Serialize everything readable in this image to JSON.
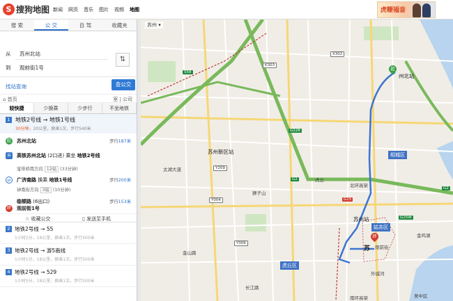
{
  "topbar": {
    "logo_mark": "S",
    "logo_text": "搜狗地图",
    "nav": [
      "新闻",
      "网页",
      "音乐",
      "图片",
      "视频",
      "地图"
    ],
    "active_nav": "地图",
    "ad_text": "虎鞭福音"
  },
  "panel": {
    "mode_tabs": [
      "搜 索",
      "公 交",
      "自 驾",
      "收藏夹"
    ],
    "active_mode": "公 交",
    "from_label": "从",
    "from_value": "苏州北站",
    "to_label": "到",
    "to_value": "观前街1号",
    "swap_icon": "⇅",
    "station_search_link": "找站查询",
    "search_button": "查公交",
    "crumb_home": "首页",
    "crumb_right": "室 | 公司",
    "pref_tabs": [
      "较快捷",
      "少换乘",
      "少步行",
      "不坐地铁"
    ],
    "active_pref": "较快捷"
  },
  "plan1": {
    "num": "1",
    "title": "地铁2号线 → 地铁1号线",
    "summary_time": "30分钟",
    "summary_rest": "，20公里，换乘1次，步行540米",
    "steps": {
      "start": {
        "name": "苏州北站",
        "walk_prefix": "步行",
        "walk": "187米"
      },
      "board1": {
        "station": "高铁苏州北站",
        "gate": "2口进",
        "ride": "乘坐",
        "line": "地铁2号线",
        "direction": "宝带桥南方向",
        "stops": "12站",
        "mins": "33分钟"
      },
      "transfer": {
        "station": "广济南路",
        "change": "换乘",
        "line": "地铁1号线",
        "walk_prefix": "步行",
        "walk": "200米",
        "direction": "钟南街方向",
        "stops": "3站",
        "mins": "10分钟"
      },
      "alight": {
        "station": "临顿路",
        "exit": "6出口",
        "walk_prefix": "步行",
        "walk": "153米"
      },
      "end": {
        "name": "观前街1号"
      }
    },
    "fav_label": "收藏公交",
    "send_label": "发送至手机"
  },
  "plans": [
    {
      "num": "2",
      "title": "地铁2号线 → 55",
      "summary": "1小时2分，18公里，换乘1次，步行400米"
    },
    {
      "num": "3",
      "title": "地铁2号线 → 游5南线",
      "summary": "1小时1分，18公里，换乘1次，步行500米"
    },
    {
      "num": "4",
      "title": "地铁2号线 → 529",
      "summary": "1小时5分，18公里，换乘1次，步行500米"
    }
  ],
  "map": {
    "city": "苏州 ▾",
    "labels": {
      "suzhou_north": "州北站",
      "suzhou_xinqu": "苏州新区站",
      "suzhou_station": "苏州站",
      "gusu": "姑苏区",
      "xiangcheng": "相城区",
      "huqiu": "虎丘区",
      "guanqian": "观前街",
      "su_short": "苏",
      "lion": "狮子山",
      "huqiu_name": "虎丘",
      "jinji": "金鸡湖",
      "waichengzhen": "外城河",
      "taihu": "太湖大道",
      "beihuan": "北环高架",
      "nanhuan": "南环高架",
      "jinshan": "金山路",
      "changjiang": "长江路",
      "wuxian": "吴中区"
    },
    "shields": {
      "s58": "S58",
      "g2": "G2",
      "g228": "G228",
      "g2b": "G2",
      "g15": "G15",
      "g15w": "G15W",
      "k303": "K303",
      "x302": "X302",
      "y209": "Y209",
      "y004": "Y004",
      "y006": "Y006"
    }
  }
}
